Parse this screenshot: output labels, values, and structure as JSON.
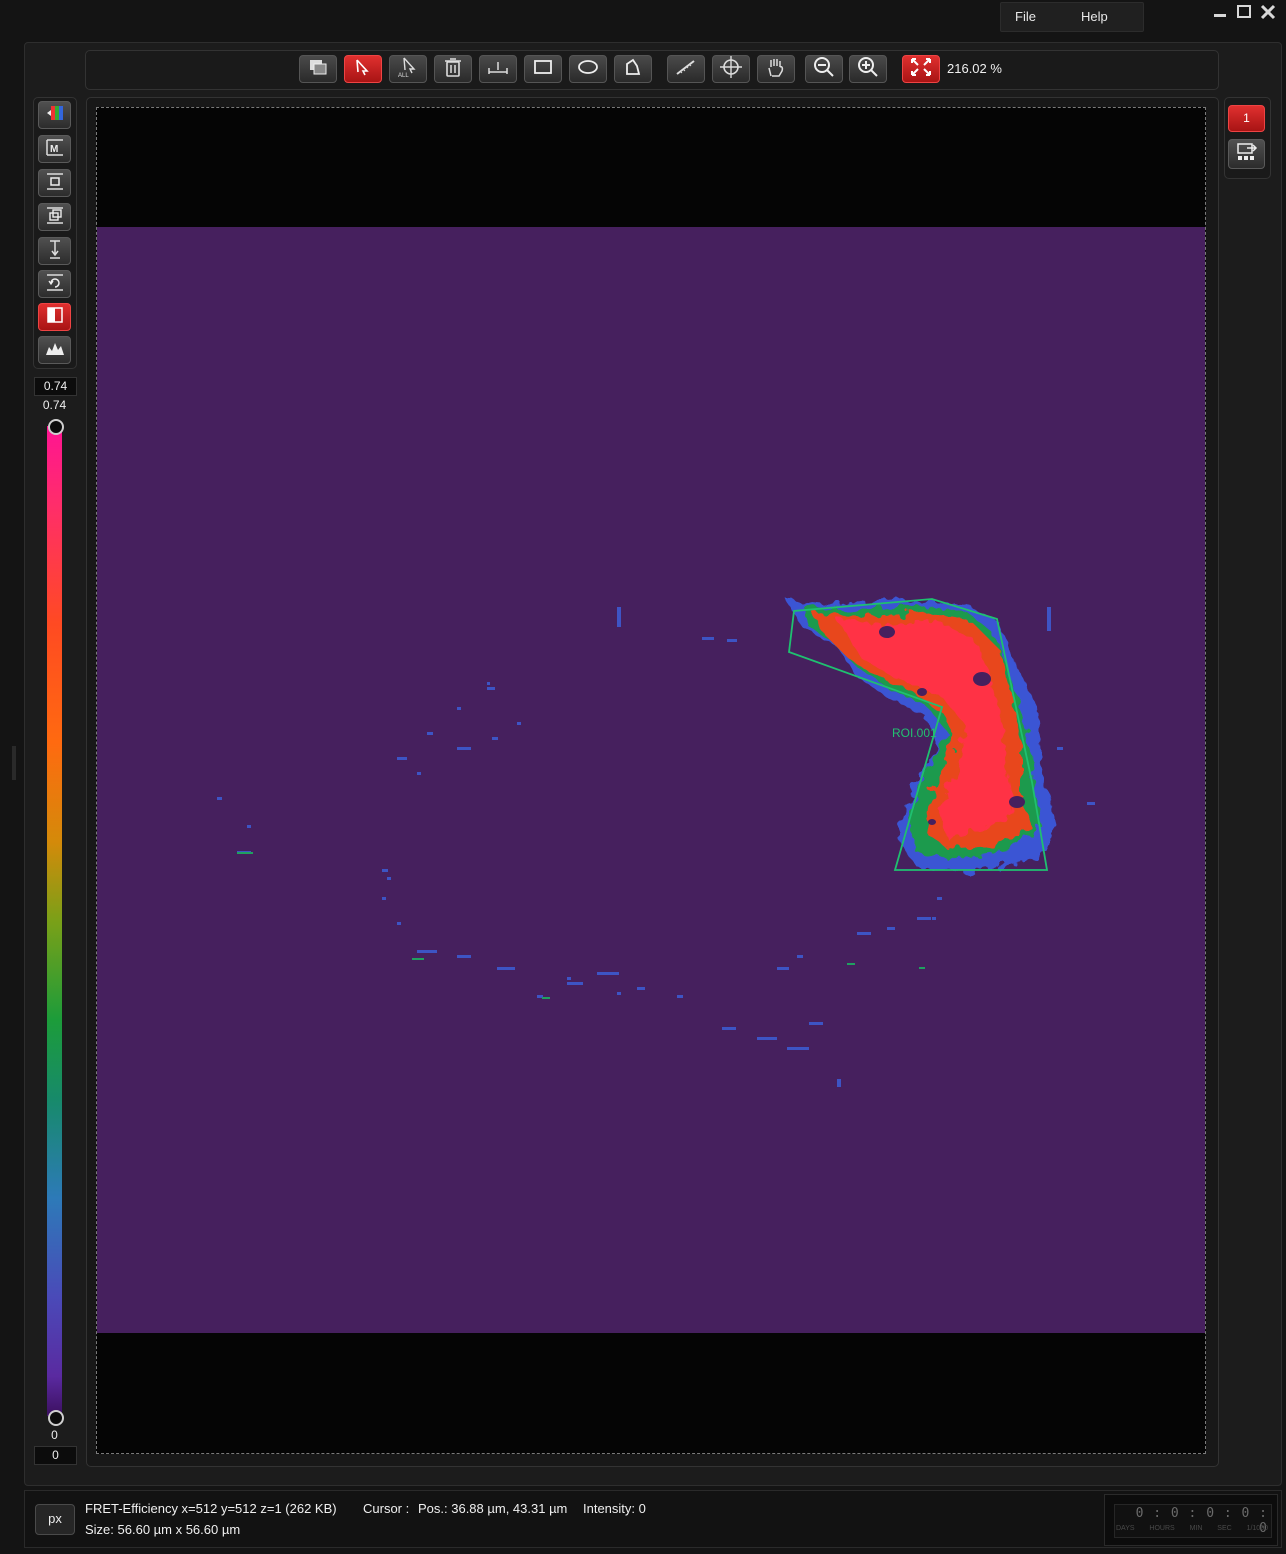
{
  "menu": {
    "file": "File",
    "help": "Help"
  },
  "toolbar": {
    "zoom_value": "216.02 %",
    "tools": [
      {
        "name": "overlay-images-icon",
        "active": false
      },
      {
        "name": "pointer-select-icon",
        "active": true
      },
      {
        "name": "select-all-icon",
        "active": false
      },
      {
        "name": "delete-trash-icon",
        "active": false
      },
      {
        "name": "line-profile-icon",
        "active": false
      },
      {
        "name": "rectangle-roi-icon",
        "active": false
      },
      {
        "name": "ellipse-roi-icon",
        "active": false
      },
      {
        "name": "polygon-roi-icon",
        "active": false
      },
      {
        "name": "ruler-icon",
        "active": false
      },
      {
        "name": "crosshair-icon",
        "active": false
      },
      {
        "name": "pan-hand-icon",
        "active": false
      },
      {
        "name": "zoom-out-icon",
        "active": false
      },
      {
        "name": "zoom-in-icon",
        "active": false
      },
      {
        "name": "fit-to-window-icon",
        "active": true
      }
    ]
  },
  "left_tools": [
    {
      "name": "color-lut-icon",
      "active": false
    },
    {
      "name": "max-projection-icon",
      "active": false
    },
    {
      "name": "stack-layer-icon",
      "active": false
    },
    {
      "name": "stack-multi-icon",
      "active": false
    },
    {
      "name": "z-position-icon",
      "active": false
    },
    {
      "name": "rotate-view-icon",
      "active": false
    },
    {
      "name": "split-view-icon",
      "active": true
    },
    {
      "name": "histogram-icon",
      "active": false
    }
  ],
  "lut": {
    "max_box": "0.74",
    "max_label": "0.74",
    "min_label": "0",
    "min_box": "0"
  },
  "image": {
    "roi_label": "ROI.001"
  },
  "channel": {
    "number": "1"
  },
  "status": {
    "unit_button": "px",
    "image_info": "FRET-Efficiency x=512 y=512 z=1  (262 KB)",
    "cursor_label": "Cursor :",
    "cursor_pos": "Pos.: 36.88 µm, 43.31 µm",
    "intensity": "Intensity: 0",
    "size": "Size: 56.60 µm x 56.60 µm"
  },
  "timer": {
    "digits": "0 : 0 : 0 : 0 :  0",
    "units": [
      "DAYS",
      "HOURS",
      "MIN",
      "SEC",
      "1/1000"
    ]
  },
  "colors": {
    "accent_red": "#d42020",
    "background_image": "#46205e",
    "roi_outline": "#1fc070"
  }
}
